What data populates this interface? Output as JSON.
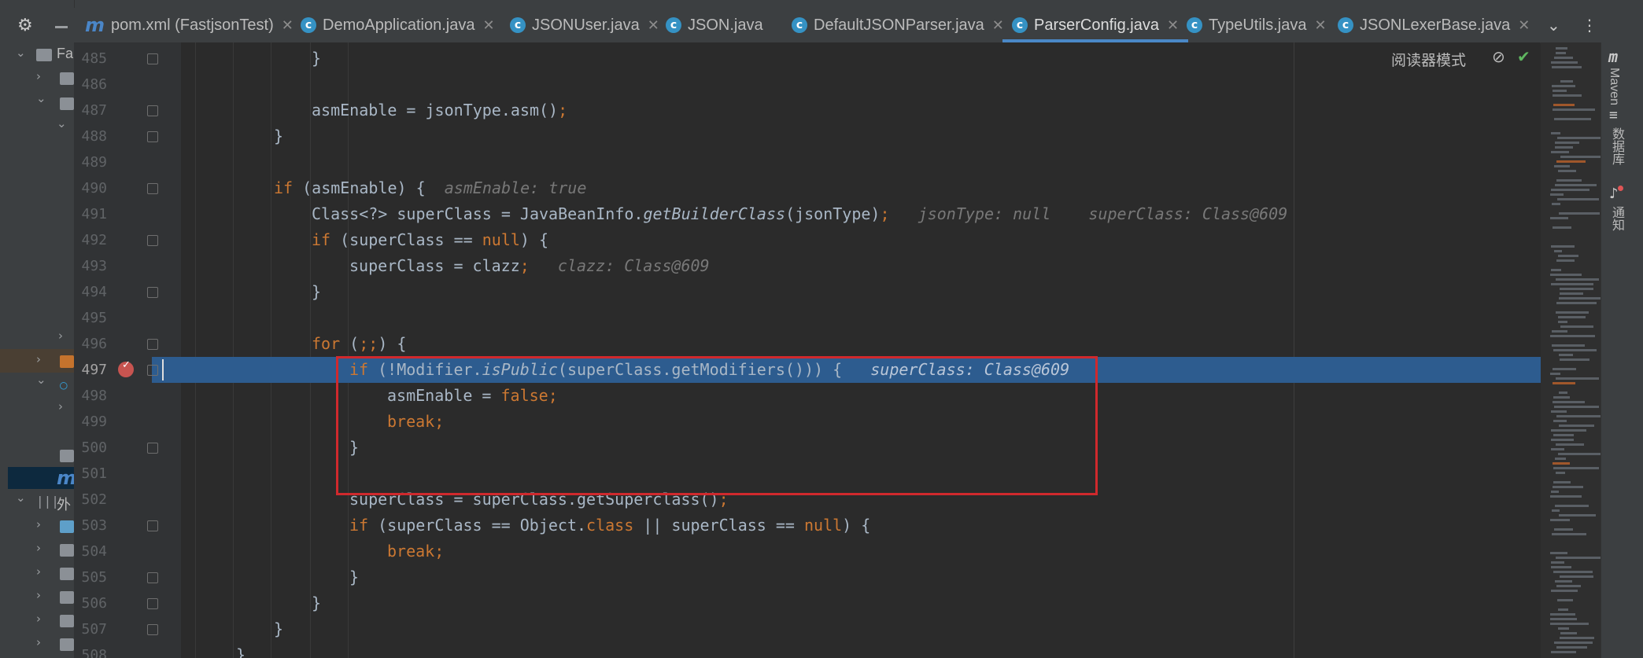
{
  "tabs": [
    {
      "label": "pom.xml (FastjsonTest)",
      "icon": "maven-icon"
    },
    {
      "label": "DemoApplication.java",
      "icon": "class-icon"
    },
    {
      "label": "JSONUser.java",
      "icon": "class-icon"
    },
    {
      "label": "JSON.java",
      "icon": "class-icon"
    },
    {
      "label": "DefaultJSONParser.java",
      "icon": "class-icon"
    },
    {
      "label": "ParserConfig.java",
      "icon": "class-icon",
      "active": true
    },
    {
      "label": "TypeUtils.java",
      "icon": "class-icon"
    },
    {
      "label": "JSONLexerBase.java",
      "icon": "class-icon"
    }
  ],
  "project_panel": {
    "root_label": "Fa",
    "ext_label": "外"
  },
  "reader_mode_label": "阅读器模式",
  "right_tools": {
    "maven": "Maven",
    "database": "数据库",
    "notifications": "通知"
  },
  "lines": [
    {
      "n": "485",
      "text": "}"
    },
    {
      "n": "486",
      "text": ""
    },
    {
      "n": "487",
      "text": "asmEnable = jsonType.asm();"
    },
    {
      "n": "488",
      "text": "}"
    },
    {
      "n": "489",
      "text": ""
    },
    {
      "n": "490",
      "text": "if (asmEnable) {",
      "hint": "asmEnable: true"
    },
    {
      "n": "491",
      "text": "Class<?> superClass = JavaBeanInfo.getBuilderClass(jsonType);",
      "hint": "jsonType: null    superClass: Class@609"
    },
    {
      "n": "492",
      "text": "if (superClass == null) {"
    },
    {
      "n": "493",
      "text": "superClass = clazz;",
      "hint": "clazz: Class@609"
    },
    {
      "n": "494",
      "text": "}"
    },
    {
      "n": "495",
      "text": ""
    },
    {
      "n": "496",
      "text": "for (;;) {"
    },
    {
      "n": "497",
      "text": "if (!Modifier.isPublic(superClass.getModifiers())) {",
      "hint": "superClass: Class@609"
    },
    {
      "n": "498",
      "text": "asmEnable = false;"
    },
    {
      "n": "499",
      "text": "break;"
    },
    {
      "n": "500",
      "text": "}"
    },
    {
      "n": "501",
      "text": ""
    },
    {
      "n": "502",
      "text": "superClass = superClass.getSuperclass();"
    },
    {
      "n": "503",
      "text": "if (superClass == Object.class || superClass == null) {"
    },
    {
      "n": "504",
      "text": "break;"
    },
    {
      "n": "505",
      "text": "}"
    },
    {
      "n": "506",
      "text": "}"
    },
    {
      "n": "507",
      "text": "}"
    },
    {
      "n": "508",
      "text": "}"
    }
  ],
  "current_line": "497"
}
